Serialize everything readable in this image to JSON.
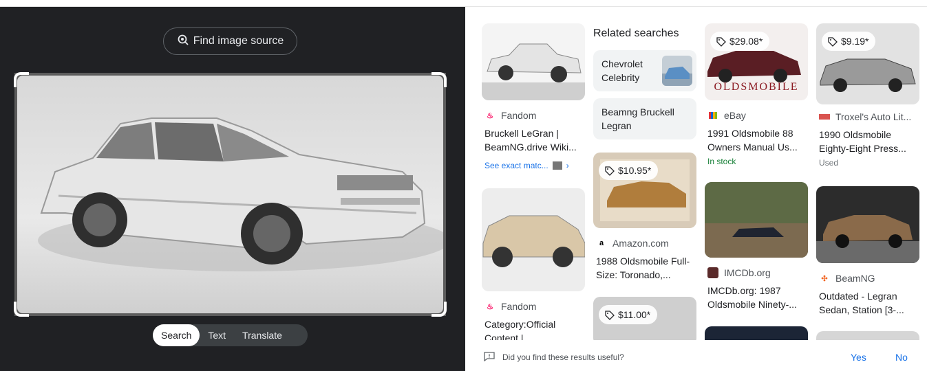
{
  "left_pane": {
    "find_source_label": "Find image source",
    "modes": [
      "Search",
      "Text",
      "Translate"
    ]
  },
  "results": {
    "related_title": "Related searches",
    "related": [
      "Chevrolet Celebrity",
      "Beamng Bruckell Legran"
    ],
    "col1": [
      {
        "source": "Fandom",
        "title": "Bruckell LeGran | BeamNG.drive Wiki...",
        "exact": "See exact matc..."
      },
      {
        "source": "Fandom",
        "title": "Category:Official Content |..."
      }
    ],
    "col2": [
      {
        "price": "$10.95*",
        "source": "Amazon.com",
        "title": "1988 Oldsmobile Full-Size: Toronado,..."
      },
      {
        "price": "$11.00*"
      }
    ],
    "col3": [
      {
        "price": "$29.08*",
        "source": "eBay",
        "title": "1991 Oldsmobile 88 Owners Manual Us...",
        "status": "In stock",
        "brand_text": "OLDSMOBILE"
      },
      {
        "source": "IMCDb.org",
        "title": "IMCDb.org: 1987 Oldsmobile Ninety-..."
      }
    ],
    "col4": [
      {
        "price": "$9.19*",
        "source": "Troxel's Auto Lit...",
        "title": "1990 Oldsmobile Eighty-Eight Press...",
        "status": "Used"
      },
      {
        "source": "BeamNG",
        "title": "Outdated - Legran Sedan, Station [3-..."
      }
    ]
  },
  "footer": {
    "question": "Did you find these results useful?",
    "yes": "Yes",
    "no": "No"
  }
}
